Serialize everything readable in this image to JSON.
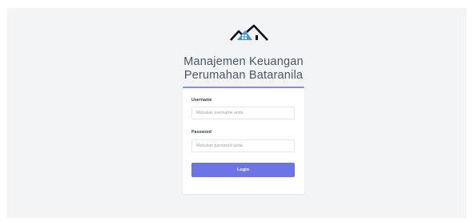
{
  "app": {
    "title_line1": "Manajemen Keuangan",
    "title_line2": "Perumahan Bataranila"
  },
  "logo": {
    "icon": "house-roof-logo-icon",
    "colors": [
      "#000000",
      "#3b9ad9"
    ]
  },
  "form": {
    "username_label": "Username",
    "username_placeholder": "Masukan username anda",
    "username_value": "",
    "password_label": "Password",
    "password_placeholder": "Masukan password anda",
    "password_value": "",
    "login_label": "Login"
  },
  "colors": {
    "accent": "#6c74e8",
    "card_border_top": "#818cf8",
    "background": "#f3f4f6"
  }
}
